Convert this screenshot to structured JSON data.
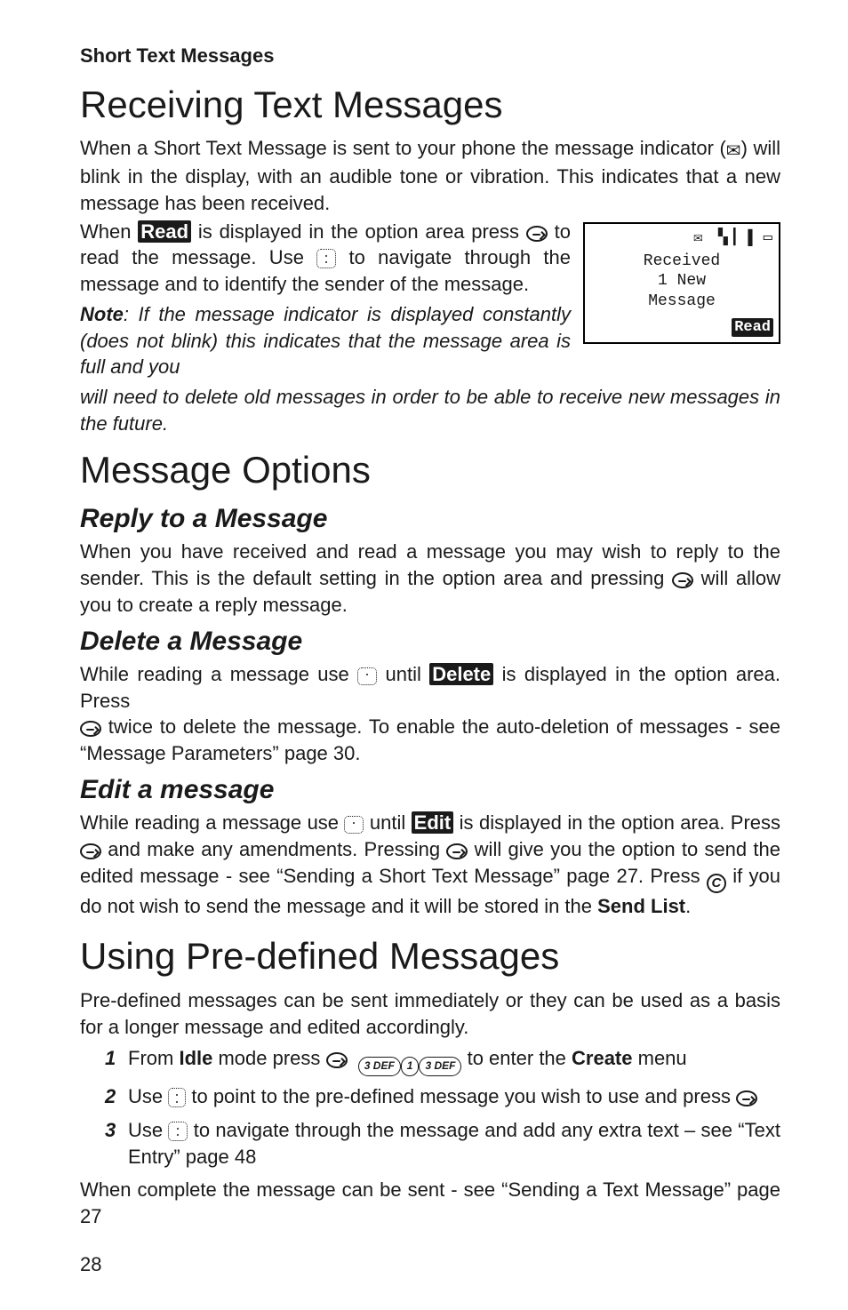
{
  "page": {
    "number": "28"
  },
  "section": {
    "short_text_messages": "Short Text Messages"
  },
  "h1": {
    "receiving": "Receiving Text Messages",
    "message_options": "Message Options",
    "predefined": "Using Pre-defined Messages"
  },
  "h2": {
    "reply": "Reply to a Message",
    "delete": "Delete a Message",
    "edit": "Edit a message"
  },
  "labels": {
    "read": "Read",
    "delete": "Delete",
    "edit": "Edit",
    "idle": "Idle",
    "create": "Create",
    "send_list": "Send List",
    "when": "When ",
    "note_label": "Note"
  },
  "keys": {
    "three": "3 DEF",
    "one": "1"
  },
  "phone": {
    "top_icons": "✉  ▝▖▎▐ ▭",
    "line1": "Received",
    "line2": "1 New",
    "line3": "Message",
    "softkey": "Read"
  },
  "receiving": {
    "p1": "When a Short Text Message is sent to your phone the message indicator (",
    "p1b": ") will blink in the display, with an audible tone or vibration. This indicates that a new message has been received.",
    "p2a": " is displayed in the option area press ",
    "p2b": " to read the message. Use ",
    "p2c": " to navigate through the message and to identify the sender of the message.",
    "note_a": ": If the message indicator is displayed constantly (does not blink) this indicates that the message area is full and you",
    "note_b": "will need to delete old messages in order to be able to receive new messages in the future."
  },
  "reply": {
    "p": "When you have received and read a message you may wish to reply to the sender. This is the default setting in the option area and pressing ",
    "p2": " will allow you to create a reply message."
  },
  "delete": {
    "p_a": "While reading a message use ",
    "p_b": " until ",
    "p_c": " is displayed in the option area. Press ",
    "p_d": " twice to delete the message. To enable the auto-deletion of messages - see “Message Parameters” page 30."
  },
  "edit": {
    "p_a": "While reading a message use ",
    "p_b": " until ",
    "p_c": " is displayed in the option area. Press ",
    "p_d": " and make any amendments. Pressing ",
    "p_e": " will give you the option to send the edited message - see “Sending a Short Text Message” page 27. Press ",
    "p_f": " if you do not wish to send the message and it will be stored in the ",
    "p_g": "."
  },
  "predef": {
    "intro": "Pre-defined messages can be sent immediately or they can be used as a basis for a longer message and edited accordingly.",
    "s1a": "From ",
    "s1b": " mode press ",
    "s1c": " to enter the ",
    "s1d": " menu",
    "s2a": "Use ",
    "s2b": " to point to the pre-defined message you wish to use and press ",
    "s3a": "Use ",
    "s3b": " to navigate through the message and add any extra text – see “Text Entry” page 48",
    "final": "When complete the message can be sent - see “Sending a Text Message” page 27"
  },
  "nums": {
    "one": "1",
    "two": "2",
    "three": "3"
  }
}
